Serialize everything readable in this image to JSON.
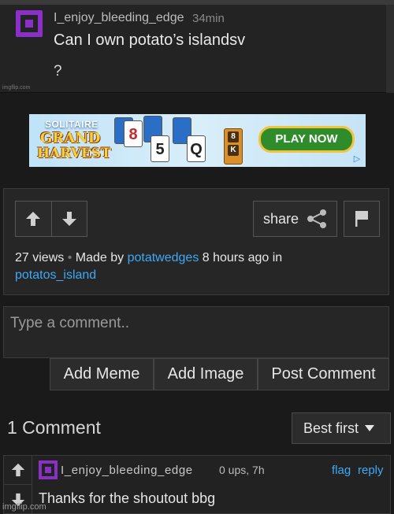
{
  "meme": {
    "username": "I_enjoy_bleeding_edge",
    "time": "34min",
    "text": "Can I own potato’s islandsv",
    "question": "?",
    "watermark": "imgflip.com"
  },
  "ad": {
    "line1": "SOLITAIRE",
    "line2": "GRAND",
    "line3": "HARVEST",
    "cards": [
      "8",
      "5",
      "Q"
    ],
    "lock_text": [
      "8",
      "K"
    ],
    "cta": "PLAY NOW"
  },
  "post_actions": {
    "share_label": "share",
    "views": "27 views",
    "made_by_prefix": "Made by",
    "author": "potatwedges",
    "time_ago": "8 hours ago in",
    "stream": "potatos_island"
  },
  "comment_box": {
    "placeholder": "Type a comment..",
    "add_meme": "Add Meme",
    "add_image": "Add Image",
    "post_comment": "Post Comment"
  },
  "comments_header": {
    "count_label": "1 Comment",
    "sort_selected": "Best first"
  },
  "comments": [
    {
      "username": "I_enjoy_bleeding_edge",
      "meta": "0 ups, 7h",
      "flag": "flag",
      "reply": "reply",
      "text": "Thanks for the shoutout bbg"
    }
  ],
  "footer_watermark": "imgflip.com",
  "colors": {
    "accent_link": "#3fa9f5",
    "avatar_purple": "#8b2fc9",
    "background": "#1a1a1a"
  }
}
